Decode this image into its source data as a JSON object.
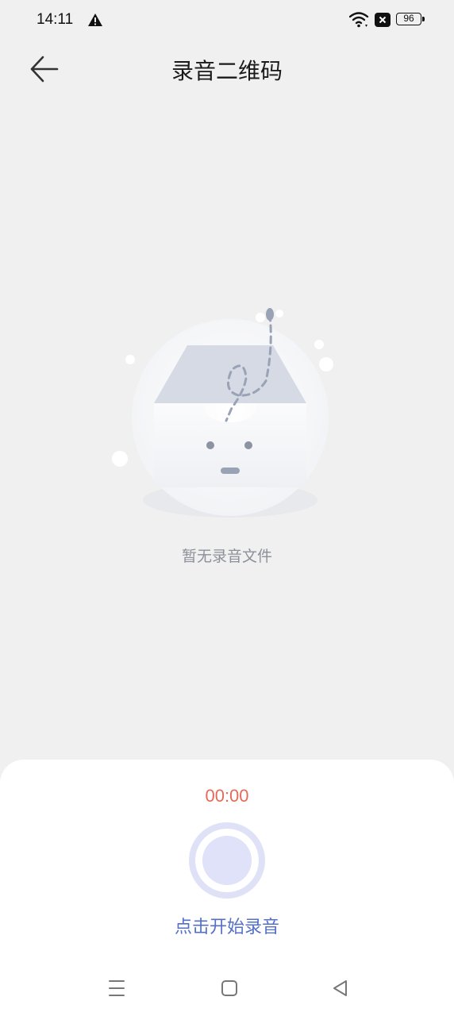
{
  "status_bar": {
    "time": "14:11",
    "battery": "96",
    "icons": [
      "warning-icon",
      "wifi-icon",
      "notification-x-icon"
    ]
  },
  "header": {
    "title": "录音二维码",
    "back_icon": "arrow-left-icon"
  },
  "empty_state": {
    "message": "暂无录音文件",
    "illustration": "empty-inbox-icon"
  },
  "recorder": {
    "timer": "00:00",
    "hint": "点击开始录音",
    "timer_color": "#e46a5a",
    "accent_color": "#5470c6"
  },
  "nav_bar": {
    "icons": [
      "menu-icon",
      "home-square-icon",
      "back-triangle-icon"
    ]
  }
}
